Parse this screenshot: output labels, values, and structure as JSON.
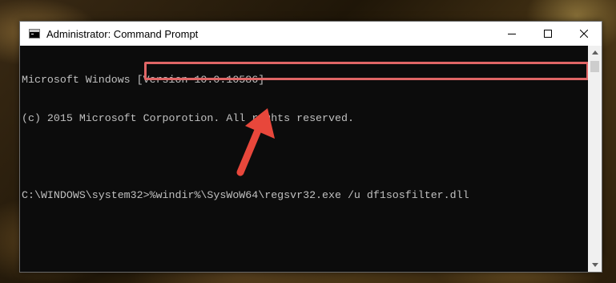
{
  "window": {
    "title": "Administrator: Command Prompt",
    "icon": "cmd-icon"
  },
  "controls": {
    "minimize": "minimize-icon",
    "maximize": "maximize-icon",
    "close": "close-icon"
  },
  "console": {
    "lines": [
      "Microsoft Windows [Version 10.0.10586]",
      "(c) 2015 Microsoft Corporotion. All rights reserved.",
      "",
      "C:\\WINDOWS\\system32>%windir%\\SysWoW64\\regsvr32.exe /u df1sosfilter.dll"
    ],
    "prompt": "C:\\WINDOWS\\system32>",
    "command": "%windir%\\SysWoW64\\regsvr32.exe /u df1sosfilter.dll"
  },
  "annotation": {
    "highlight_color": "#e06666",
    "arrow_color": "#e8473b"
  },
  "colors": {
    "console_bg": "#0c0c0c",
    "console_text": "#c0c0c0"
  }
}
